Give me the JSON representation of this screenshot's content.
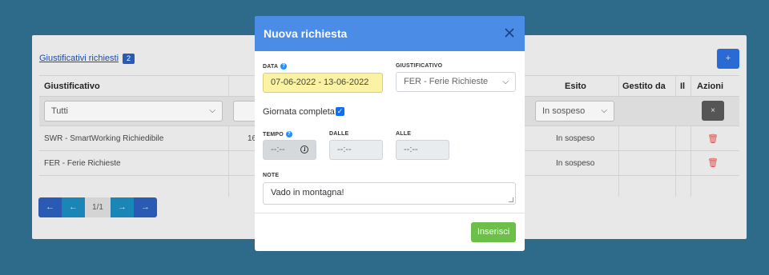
{
  "panel": {
    "title": "Giustificativi richiesti",
    "count": "2",
    "add_label": "+",
    "columns": {
      "giustificativo": "Giustificativo",
      "esito": "Esito",
      "gestito_da": "Gestito da",
      "flag": "Il",
      "azioni": "Azioni"
    },
    "filters": {
      "giustificativo": "Tutti",
      "esito": "In sospeso",
      "clear_label": "×"
    },
    "rows": [
      {
        "giustificativo": "SWR - SmartWorking Richiedibile",
        "date_partial": "16",
        "esito": "In sospeso"
      },
      {
        "giustificativo": "FER - Ferie Richieste",
        "date_partial": "",
        "esito": "In sospeso"
      }
    ],
    "pager": {
      "first": "←",
      "prev": "←",
      "page": "1/1",
      "next": "→",
      "last": "→"
    }
  },
  "modal": {
    "title": "Nuova richiesta",
    "data_label": "DATA",
    "data_value": "07-06-2022 - 13-06-2022",
    "giustificativo_label": "GIUSTIFICATIVO",
    "giustificativo_value": "FER - Ferie Richieste",
    "giornata_completa_label": "Giornata completa",
    "giornata_completa_checked": true,
    "tempo_label": "TEMPO",
    "tempo_value": "--:--",
    "dalle_label": "DALLE",
    "dalle_value": "--:--",
    "alle_label": "ALLE",
    "alle_value": "--:--",
    "note_label": "NOTE",
    "note_value": "Vado in montagna!",
    "insert_label": "Inserisci"
  },
  "colors": {
    "backdrop": "#2e6b8b",
    "modal_header": "#4a8ce6",
    "highlight": "#fbf3a3",
    "insert_button": "#6cc04a",
    "delete_icon": "#d9534f"
  },
  "icons": {
    "info": "info-circle-icon",
    "close": "close-icon",
    "delete": "trash-icon",
    "chevron": "chevron-down-icon",
    "clock": "clock-icon"
  }
}
